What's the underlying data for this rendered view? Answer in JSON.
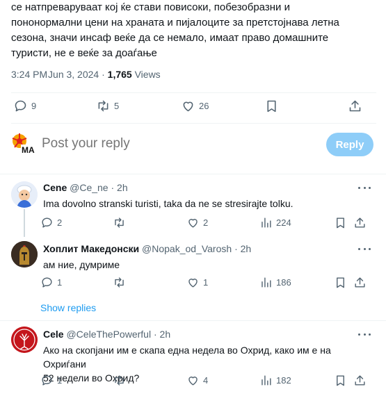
{
  "post": {
    "lines": [
      "се натпреваруваат кој ќе стави повисоки, побезобразни и",
      "пононормални цени на храната и пијалоците за претстојнава летна",
      "сезона, значи инсаф веќе да се немало, имаат право домашните",
      "туристи, не е веќе за доаѓање"
    ],
    "time": "3:24 PM",
    "separator": "·",
    "date": "Jun 3, 2024",
    "views_count": "1,765",
    "views_label": "Views",
    "stats": {
      "replies": "9",
      "reposts": "5",
      "likes": "26"
    }
  },
  "reply_box": {
    "placeholder": "Post your reply",
    "button": "Reply"
  },
  "replies": [
    {
      "name": "Cene",
      "handle": "@Ce_ne",
      "sep": "·",
      "time": "2h",
      "text": "Ima dovolno stranski turisti, taka da ne se stresirajte tolku.",
      "replies": "2",
      "reposts": "",
      "likes": "2",
      "views": "224"
    },
    {
      "name": "Хоплит Македонски",
      "handle": "@Nopak_od_Varosh",
      "sep": "·",
      "time": "2h",
      "text": "ам ние, думриме",
      "replies": "1",
      "reposts": "",
      "likes": "1",
      "views": "186"
    },
    {
      "name": "Cele",
      "handle": "@CeleThePowerful",
      "sep": "·",
      "time": "2h",
      "text_lines": [
        "Ако на скопјани им е скапа една недела во Охрид, како им е на Охриѓани",
        "52 недели во Охрид?"
      ],
      "replies": "1",
      "reposts": "",
      "likes": "4",
      "views": "182"
    }
  ],
  "show_replies": "Show replies",
  "colors": {
    "accent": "#1d9bf0",
    "muted": "#536471",
    "reply_button": "#8ecdf8"
  }
}
